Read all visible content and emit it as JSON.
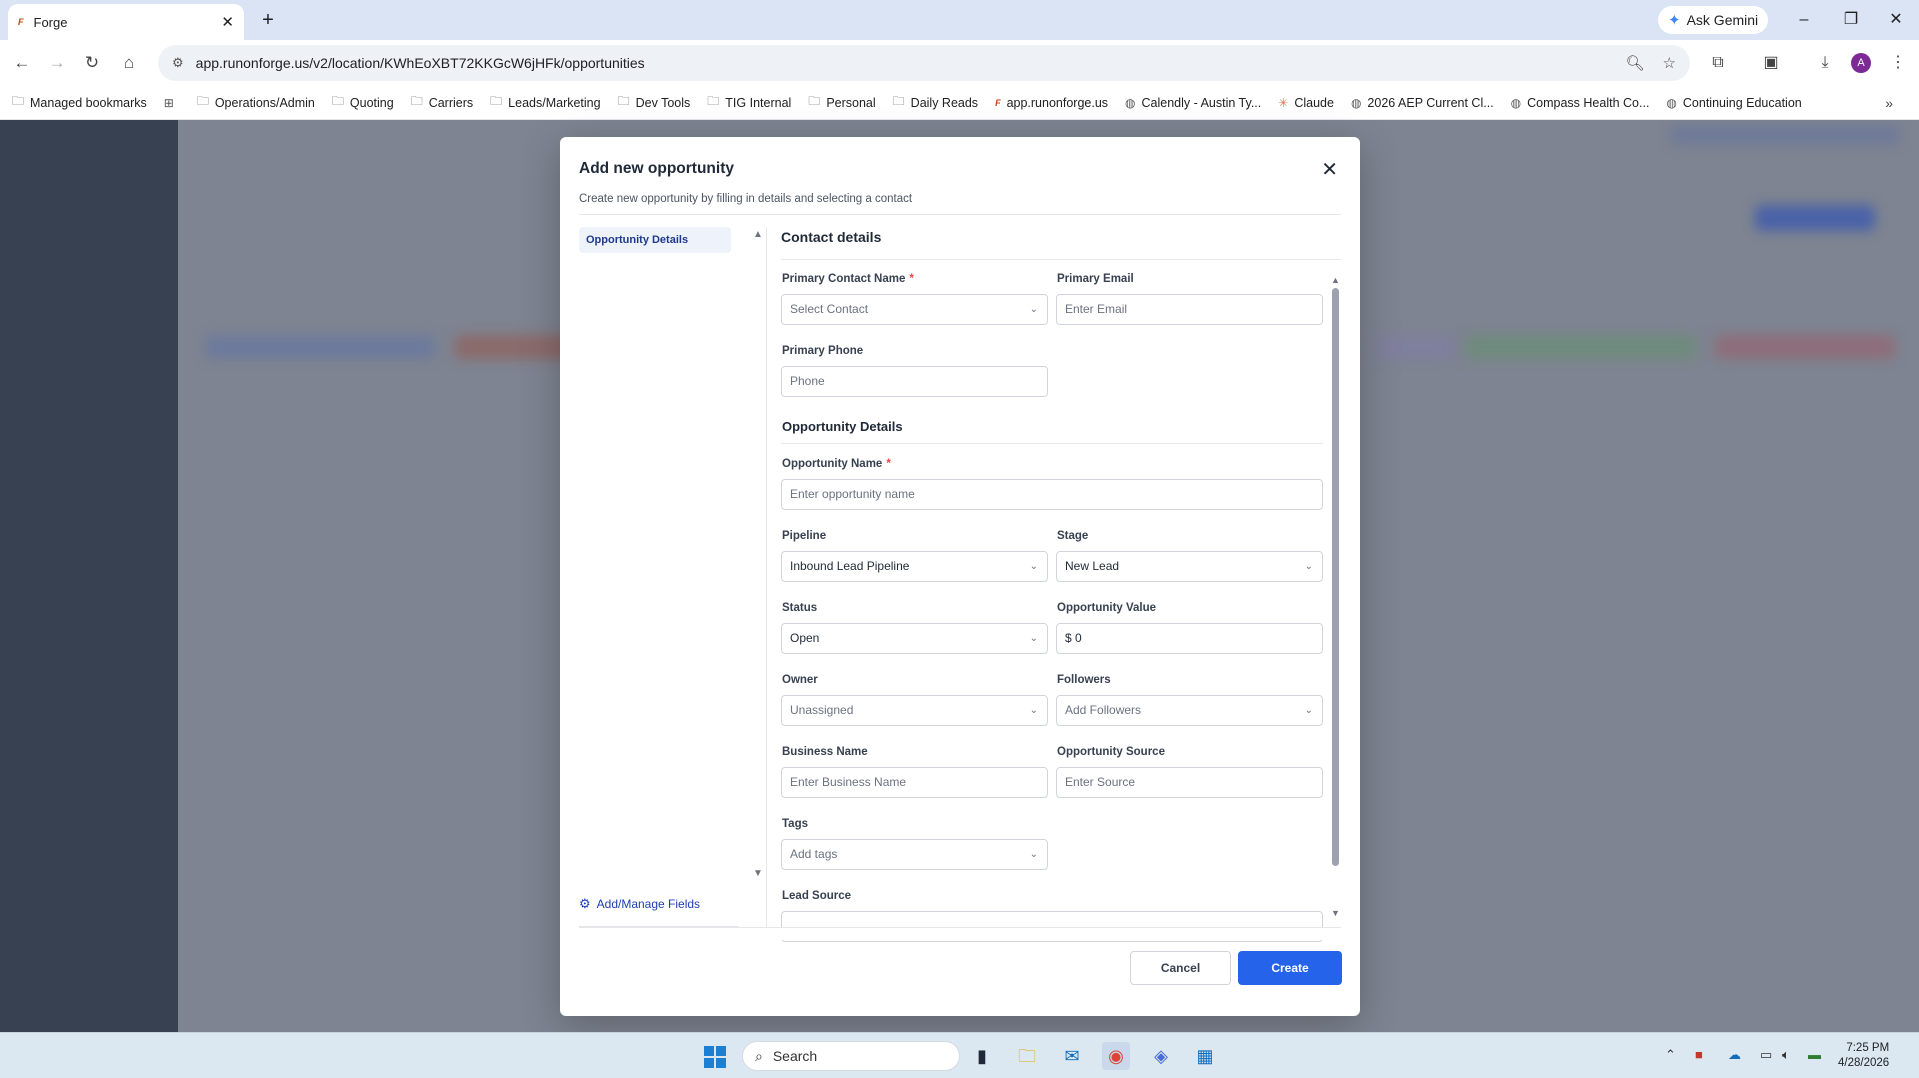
{
  "browser": {
    "tab_title": "Forge",
    "tab_favicon": "forge",
    "new_tab": "+",
    "ask_gemini": "Ask Gemini",
    "url": "app.runonforge.us/v2/location/KWhEoXBT72KKGcW6jHFk/opportunities",
    "profile_initial": "A",
    "bookmarks": [
      {
        "label": "Managed bookmarks",
        "icon": "managed-icon"
      },
      {
        "label": "",
        "icon": "apps-grid-icon"
      },
      {
        "label": "Operations/Admin",
        "icon": "folder-icon"
      },
      {
        "label": "Quoting",
        "icon": "folder-icon"
      },
      {
        "label": "Carriers",
        "icon": "folder-icon"
      },
      {
        "label": "Leads/Marketing",
        "icon": "folder-icon"
      },
      {
        "label": "Dev Tools",
        "icon": "folder-icon"
      },
      {
        "label": "TIG Internal",
        "icon": "folder-icon"
      },
      {
        "label": "Personal",
        "icon": "folder-icon"
      },
      {
        "label": "Daily Reads",
        "icon": "folder-icon"
      },
      {
        "label": "app.runonforge.us",
        "icon": "forge-icon"
      },
      {
        "label": "Calendly - Austin Ty...",
        "icon": "globe-icon"
      },
      {
        "label": "Claude",
        "icon": "claude-icon"
      },
      {
        "label": "2026 AEP Current Cl...",
        "icon": "globe-icon"
      },
      {
        "label": "Compass Health Co...",
        "icon": "globe-icon"
      },
      {
        "label": "Continuing Education",
        "icon": "globe-icon"
      }
    ]
  },
  "modal": {
    "title": "Add new opportunity",
    "subtitle": "Create new opportunity by filling in details and selecting a contact",
    "side_nav_active": "Opportunity Details",
    "manage_fields": "Add/Manage Fields",
    "contact_section": "Contact details",
    "opportunity_section": "Opportunity Details",
    "fields": {
      "primary_contact_name": {
        "label": "Primary Contact Name",
        "placeholder": "Select Contact",
        "required": "*"
      },
      "primary_email": {
        "label": "Primary Email",
        "placeholder": "Enter Email"
      },
      "primary_phone": {
        "label": "Primary Phone",
        "placeholder": "Phone"
      },
      "opportunity_name": {
        "label": "Opportunity Name",
        "placeholder": "Enter opportunity name",
        "required": "*"
      },
      "pipeline": {
        "label": "Pipeline",
        "value": "Inbound Lead Pipeline"
      },
      "stage": {
        "label": "Stage",
        "value": "New Lead"
      },
      "status": {
        "label": "Status",
        "value": "Open"
      },
      "opportunity_value": {
        "label": "Opportunity Value",
        "value": "$ 0"
      },
      "owner": {
        "label": "Owner",
        "value": "Unassigned"
      },
      "followers": {
        "label": "Followers",
        "placeholder": "Add Followers"
      },
      "business_name": {
        "label": "Business Name",
        "placeholder": "Enter Business Name"
      },
      "opportunity_source": {
        "label": "Opportunity Source",
        "placeholder": "Enter Source"
      },
      "tags": {
        "label": "Tags",
        "placeholder": "Add tags"
      },
      "lead_source": {
        "label": "Lead Source"
      }
    },
    "cancel": "Cancel",
    "create": "Create"
  },
  "taskbar": {
    "search": "Search",
    "time": "7:25 PM",
    "date": "4/28/2026"
  },
  "colors": {
    "primary": "#2563eb",
    "required": "#ef4444",
    "link": "#1e40af"
  }
}
